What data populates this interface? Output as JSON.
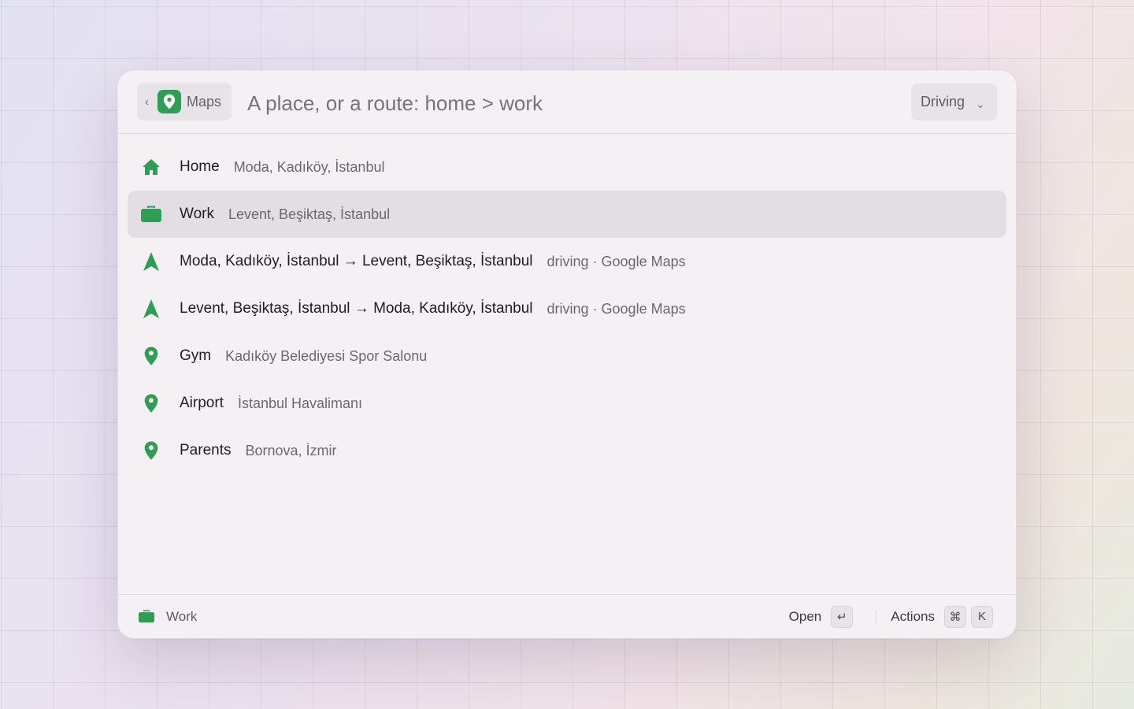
{
  "header": {
    "back_icon": "chevron-left-icon",
    "app_icon": "map-pin-icon",
    "app_name": "Maps",
    "search_placeholder": "A place, or a route: home > work",
    "search_value": "",
    "mode_label": "Driving"
  },
  "results": [
    {
      "icon": "home-icon",
      "title": "Home",
      "subtitle": "Moda, Kadıköy, İstanbul",
      "selected": false
    },
    {
      "icon": "briefcase-icon",
      "title": "Work",
      "subtitle": "Levent, Beşiktaş, İstanbul",
      "selected": true
    },
    {
      "icon": "navigation-arrow-icon",
      "title": "Moda, Kadıköy, İstanbul → Levent, Beşiktaş, İstanbul",
      "subtitle": "driving · Google Maps",
      "selected": false
    },
    {
      "icon": "navigation-arrow-icon",
      "title": "Levent, Beşiktaş, İstanbul → Moda, Kadıköy, İstanbul",
      "subtitle": "driving · Google Maps",
      "selected": false
    },
    {
      "icon": "map-pin-icon",
      "title": "Gym",
      "subtitle": "Kadıköy Belediyesi Spor Salonu",
      "selected": false
    },
    {
      "icon": "map-pin-icon",
      "title": "Airport",
      "subtitle": "İstanbul Havalimanı",
      "selected": false
    },
    {
      "icon": "map-pin-icon",
      "title": "Parents",
      "subtitle": "Bornova, İzmir",
      "selected": false
    }
  ],
  "footer": {
    "selected_icon": "briefcase-icon",
    "selected_label": "Work",
    "open_label": "Open",
    "open_key": "↵",
    "actions_label": "Actions",
    "actions_keys": [
      "⌘",
      "K"
    ]
  },
  "colors": {
    "accent": "#2f9e55",
    "selected_row": "#e3dee4",
    "window_bg": "#f4f0f4"
  }
}
